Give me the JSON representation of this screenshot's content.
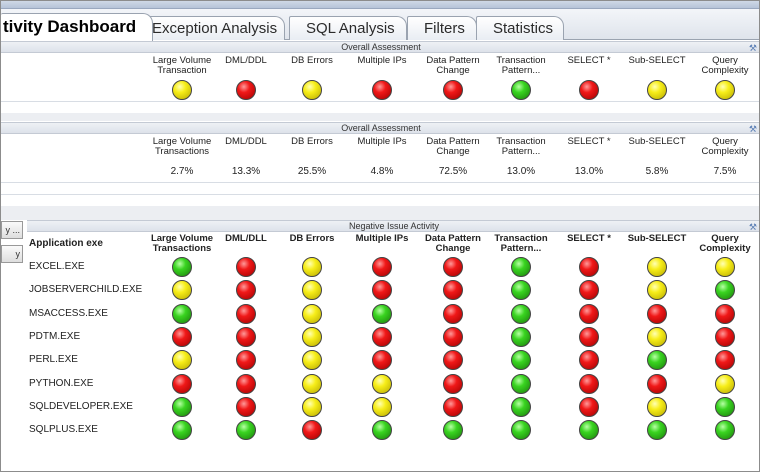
{
  "tabs": [
    {
      "label": "tivity Dashboard",
      "active": true
    },
    {
      "label": "Exception Analysis",
      "active": false
    },
    {
      "label": "SQL Analysis",
      "active": false
    },
    {
      "label": "Filters",
      "active": false
    },
    {
      "label": "Statistics",
      "active": false
    }
  ],
  "overall_status": {
    "title": "Overall Assessment",
    "columns": [
      "Large Volume Transaction",
      "DML/DDL",
      "DB Errors",
      "Multiple IPs",
      "Data Pattern Change",
      "Transaction Pattern...",
      "SELECT *",
      "Sub-SELECT",
      "Query Complexity"
    ],
    "status": [
      "yellow",
      "red",
      "yellow",
      "red",
      "red",
      "green",
      "red",
      "yellow",
      "yellow"
    ]
  },
  "overall_percent": {
    "title": "Overall Assessment",
    "columns": [
      "Large Volume Transactions",
      "DML/DDL",
      "DB Errors",
      "Multiple IPs",
      "Data Pattern Change",
      "Transaction Pattern...",
      "SELECT *",
      "Sub-SELECT",
      "Query Complexity"
    ],
    "values": [
      "2.7%",
      "13.3%",
      "25.5%",
      "4.8%",
      "72.5%",
      "13.0%",
      "13.0%",
      "5.8%",
      "7.5%"
    ]
  },
  "side_buttons": [
    "y ...",
    "y"
  ],
  "negative": {
    "title": "Negative Issue Activity",
    "first_column": "Application exe",
    "columns": [
      "Large Volume Transactions",
      "DML/DLL",
      "DB Errors",
      "Multiple IPs",
      "Data Pattern Change",
      "Transaction Pattern...",
      "SELECT *",
      "Sub-SELECT",
      "Query Complexity"
    ],
    "rows": [
      {
        "app": "EXCEL.EXE",
        "status": [
          "green",
          "red",
          "yellow",
          "red",
          "red",
          "green",
          "red",
          "yellow",
          "yellow"
        ]
      },
      {
        "app": "JOBSERVERCHILD.EXE",
        "status": [
          "yellow",
          "red",
          "yellow",
          "red",
          "red",
          "green",
          "red",
          "yellow",
          "green"
        ]
      },
      {
        "app": "MSACCESS.EXE",
        "status": [
          "green",
          "red",
          "yellow",
          "green",
          "red",
          "green",
          "red",
          "red",
          "red"
        ]
      },
      {
        "app": "PDTM.EXE",
        "status": [
          "red",
          "red",
          "yellow",
          "red",
          "red",
          "green",
          "red",
          "yellow",
          "red"
        ]
      },
      {
        "app": "PERL.EXE",
        "status": [
          "yellow",
          "red",
          "yellow",
          "red",
          "red",
          "green",
          "red",
          "green",
          "red"
        ]
      },
      {
        "app": "PYTHON.EXE",
        "status": [
          "red",
          "red",
          "yellow",
          "yellow",
          "red",
          "green",
          "red",
          "red",
          "yellow"
        ]
      },
      {
        "app": "SQLDEVELOPER.EXE",
        "status": [
          "green",
          "red",
          "yellow",
          "yellow",
          "red",
          "green",
          "red",
          "yellow",
          "green"
        ]
      },
      {
        "app": "SQLPLUS.EXE",
        "status": [
          "green",
          "green",
          "red",
          "green",
          "green",
          "green",
          "green",
          "green",
          "green"
        ]
      }
    ]
  },
  "icons": {
    "tool": "wrench-icon"
  }
}
